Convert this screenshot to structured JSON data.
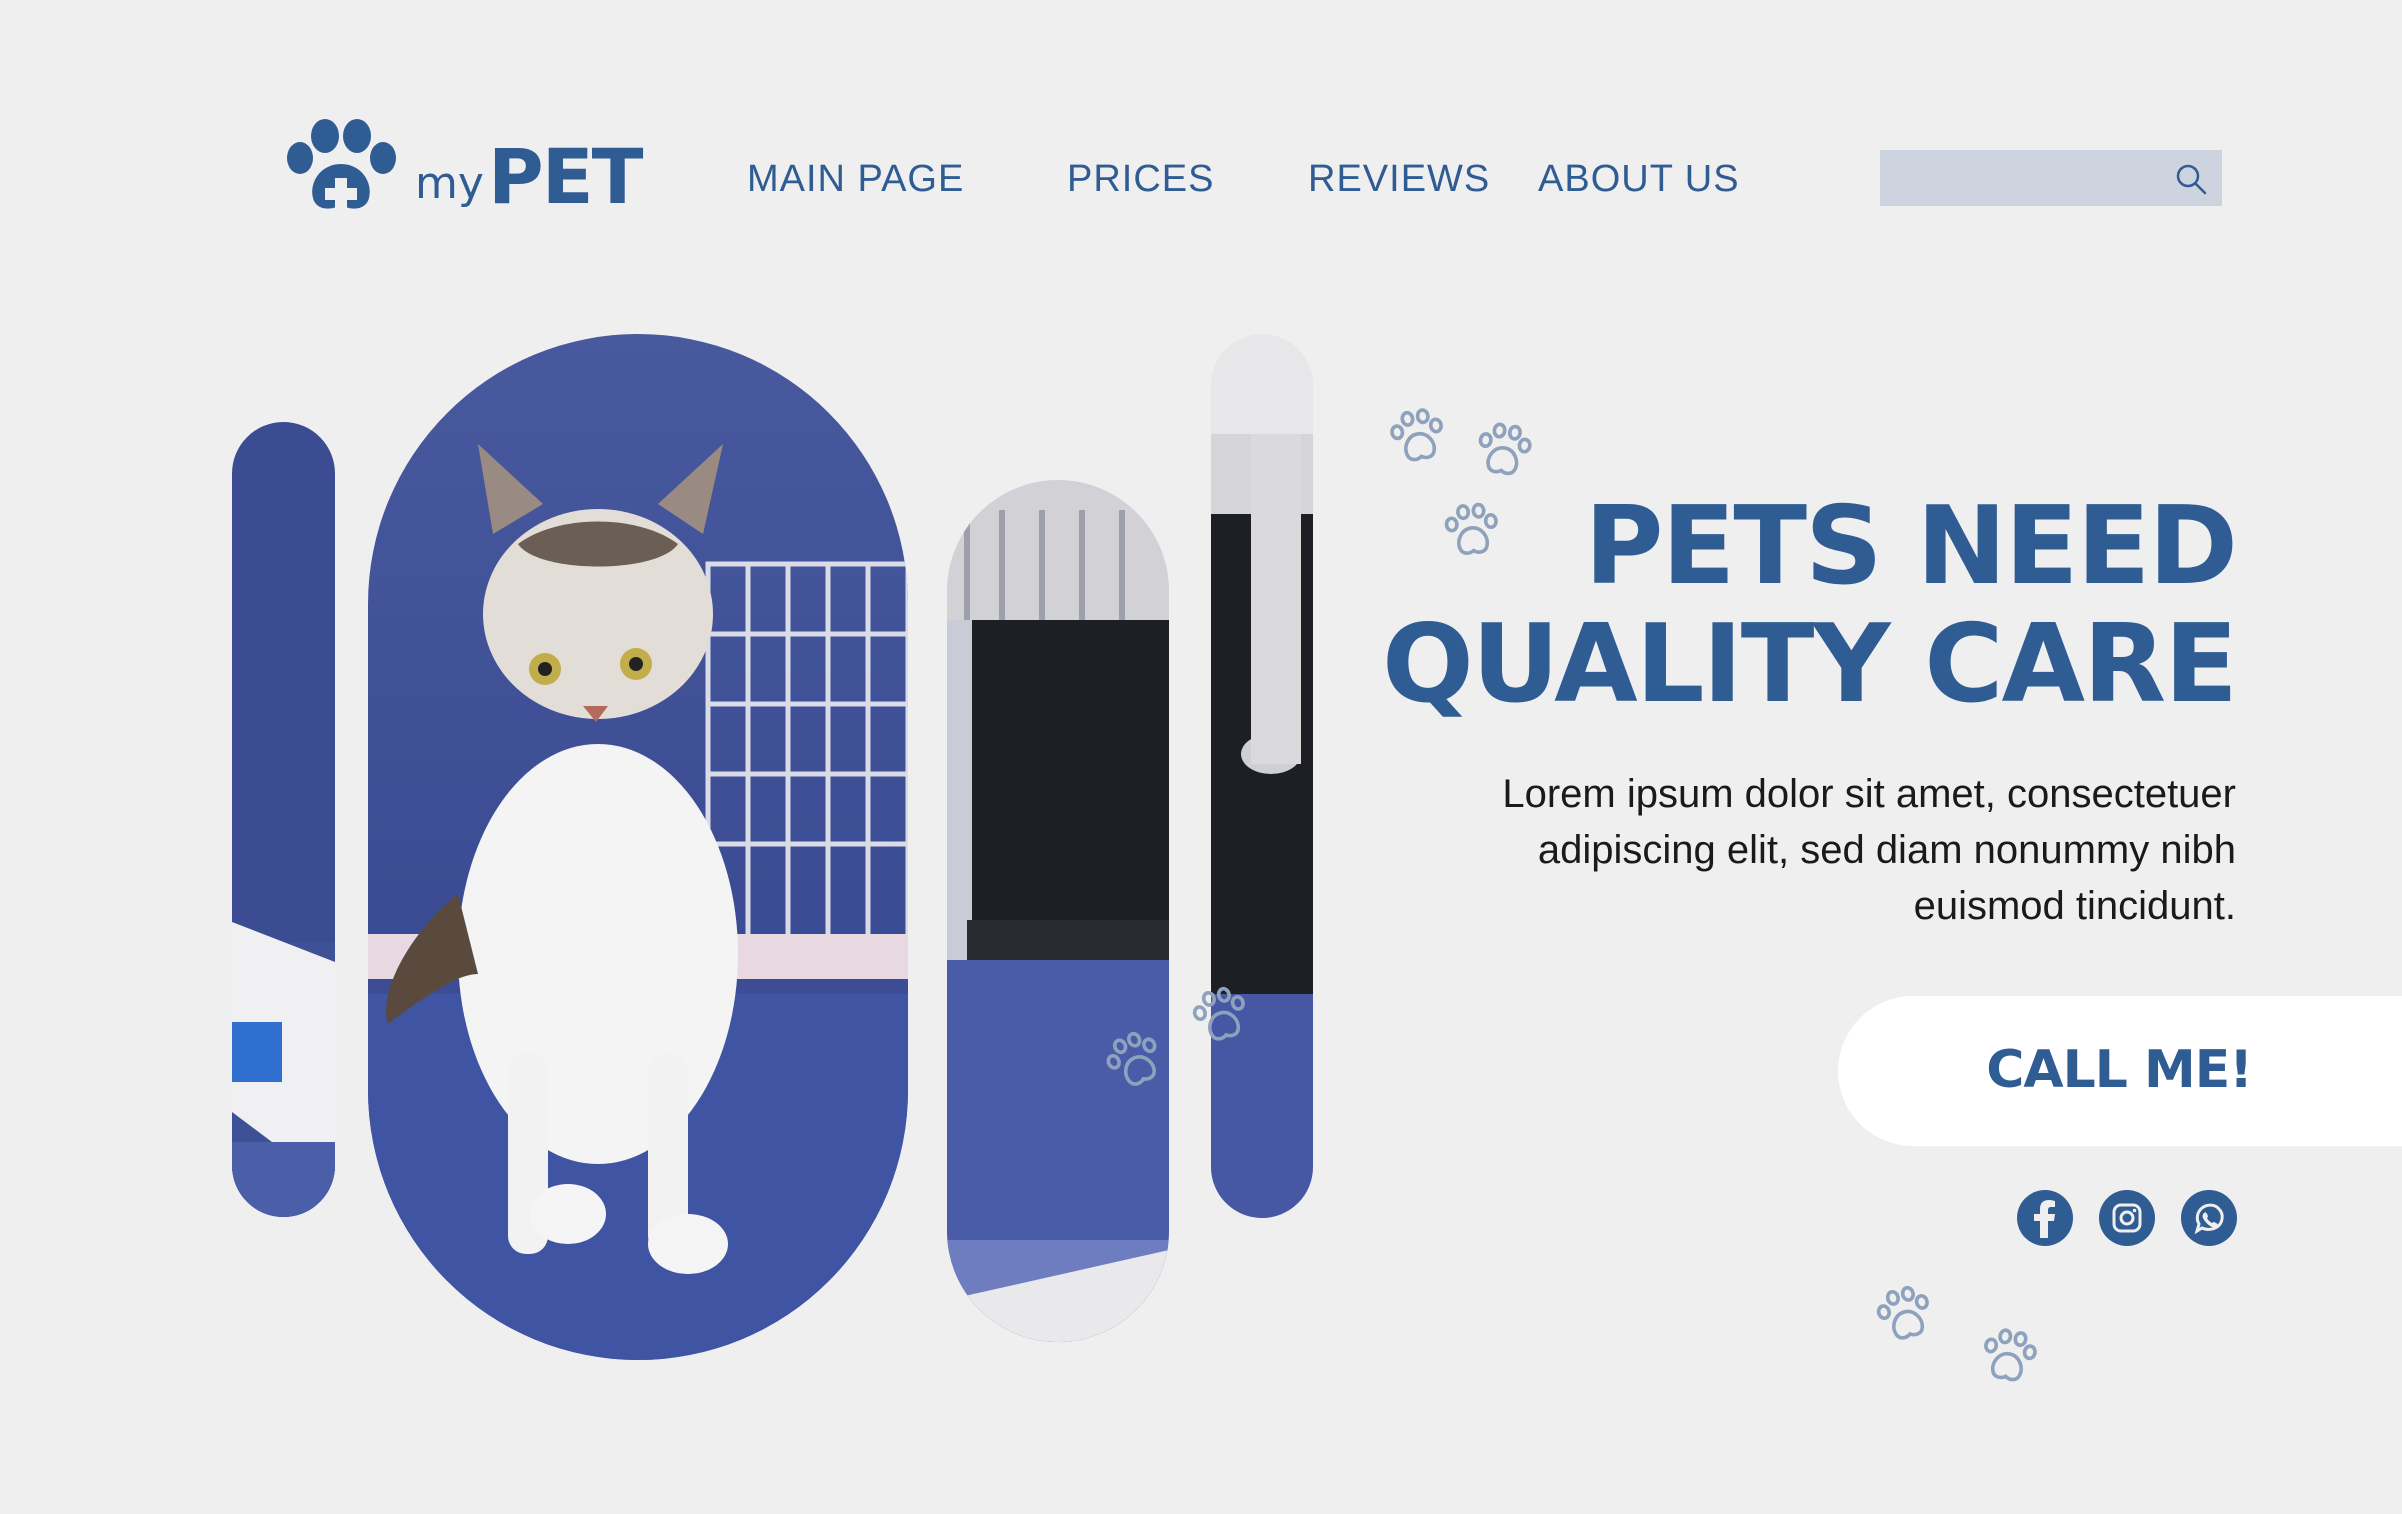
{
  "brand": {
    "my": "my",
    "pet": "PET"
  },
  "nav": [
    {
      "label": "MAIN PAGE"
    },
    {
      "label": "PRICES"
    },
    {
      "label": "REVIEWS"
    },
    {
      "label": "ABOUT US"
    }
  ],
  "search": {
    "placeholder": "",
    "icon": "search-icon"
  },
  "hero": {
    "title_line1": "PETS NEED",
    "title_line2": "QUALITY CARE",
    "body_line1": "Lorem ipsum dolor sit amet, consectetuer",
    "body_line2": "adipiscing elit, sed diam nonummy nibh",
    "body_line3": "euismod tincidunt."
  },
  "cta": {
    "label": "CALL ME!"
  },
  "social": [
    {
      "icon": "facebook-icon"
    },
    {
      "icon": "instagram-icon"
    },
    {
      "icon": "whatsapp-icon"
    }
  ],
  "colors": {
    "background": "#efefef",
    "primary": "#2f5c93",
    "search_bg": "#cdd4df",
    "photo_blue": "#3c4f95",
    "paw_outline": "#8ea1bd"
  }
}
